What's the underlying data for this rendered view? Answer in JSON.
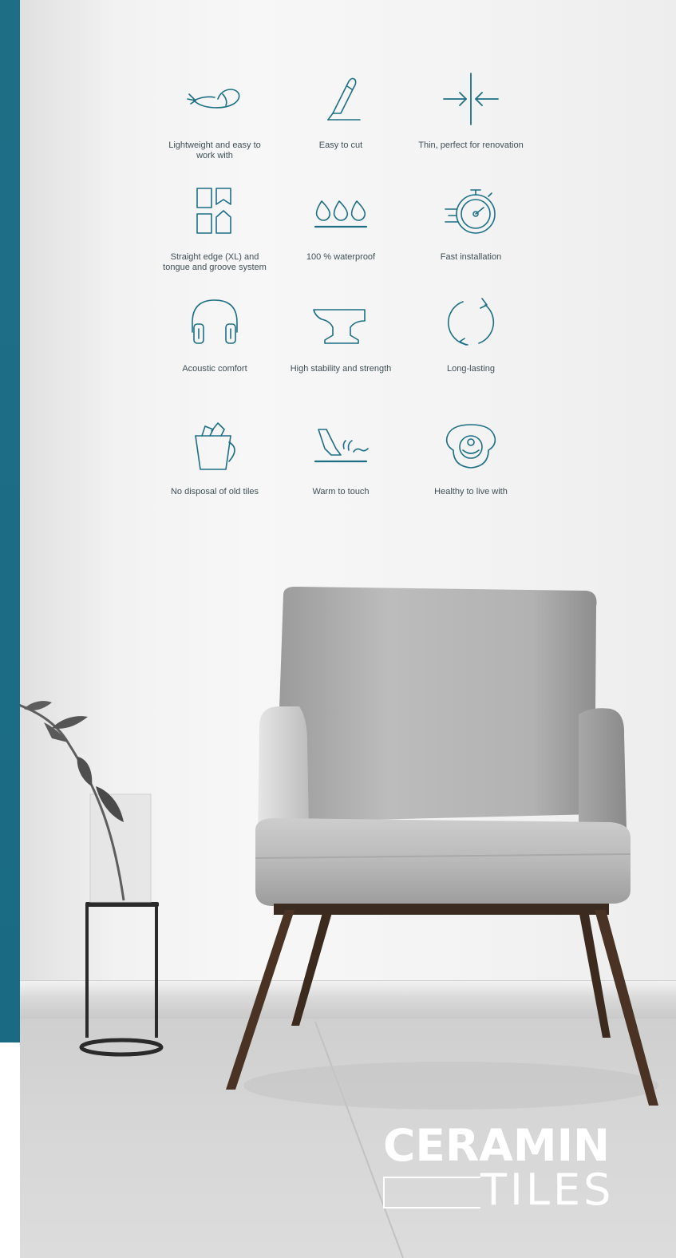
{
  "features": [
    {
      "icon": "feather-icon",
      "label": "Lightweight and easy to work with"
    },
    {
      "icon": "cutter-knife-icon",
      "label": "Easy to cut"
    },
    {
      "icon": "arrows-inward-icon",
      "label": "Thin, perfect for renovation"
    },
    {
      "icon": "tile-grid-icon",
      "label": "Straight edge (XL) and tongue and groove system"
    },
    {
      "icon": "water-drops-icon",
      "label": "100 % waterproof"
    },
    {
      "icon": "stopwatch-icon",
      "label": "Fast installation"
    },
    {
      "icon": "headphones-icon",
      "label": "Acoustic comfort"
    },
    {
      "icon": "anvil-icon",
      "label": "High stability and strength"
    },
    {
      "icon": "cycle-arrows-icon",
      "label": "Long-lasting"
    },
    {
      "icon": "bucket-icon",
      "label": "No disposal of old tiles"
    },
    {
      "icon": "warm-floor-icon",
      "label": "Warm to touch"
    },
    {
      "icon": "pacifier-icon",
      "label": "Healthy to live with"
    }
  ],
  "brand": {
    "line1": "CERAMIN",
    "line2": "TILES"
  },
  "colors": {
    "accent": "#1e6f86",
    "icon": "#1d6f85",
    "text": "#3f4f56"
  }
}
